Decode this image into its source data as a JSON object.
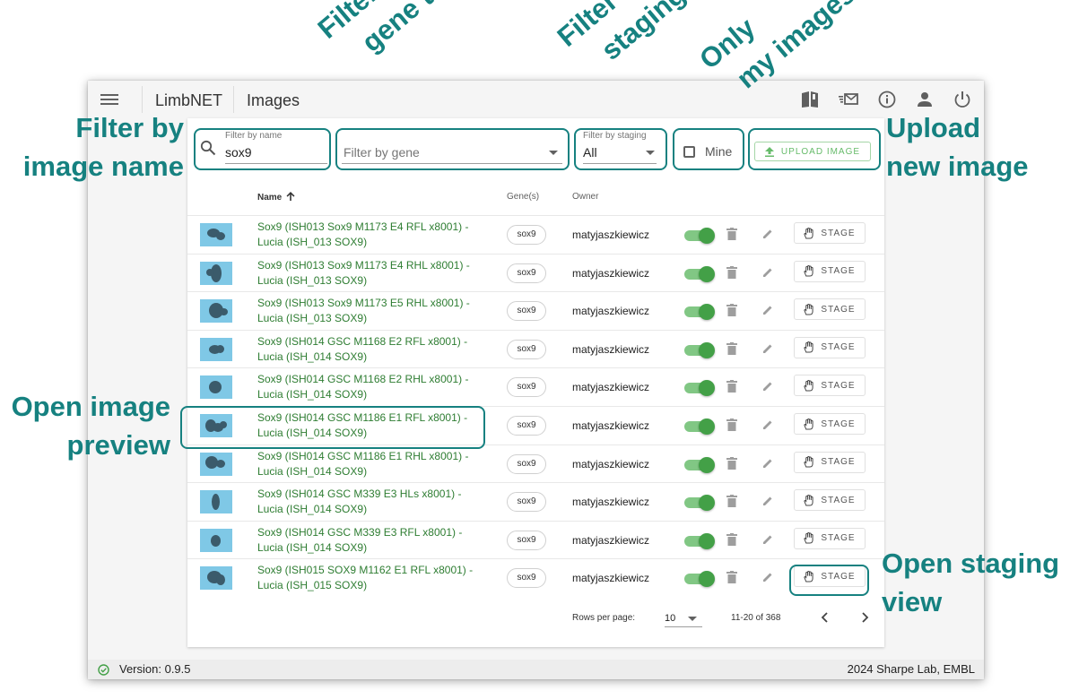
{
  "app": {
    "name": "LimbNET",
    "page_title": "Images",
    "version": "Version: 0.9.5",
    "credit": "2024 Sharpe Lab, EMBL",
    "accent_color": "#168180",
    "link_color": "#2e7d32",
    "toggle_color": "#43a047"
  },
  "header_icons": [
    "book-icon",
    "mail-icon",
    "info-icon",
    "account-icon",
    "power-icon"
  ],
  "filters": {
    "name_label": "Filter by name",
    "name_value": "sox9",
    "gene_placeholder": "Filter by gene",
    "staging_label": "Filter by staging",
    "staging_value": "All",
    "mine_label": "Mine",
    "upload_label": "UPLOAD IMAGE"
  },
  "table": {
    "columns": {
      "name": "Name",
      "genes": "Gene(s)",
      "owner": "Owner"
    },
    "sort_icon": "arrow-up-icon",
    "stage_label": "STAGE",
    "rows": [
      {
        "line1": "Sox9 (ISH013 Sox9 M1173 E4 RFL x8001) -",
        "line2": "Lucia (ISH_013 SOX9)",
        "gene": "sox9",
        "owner": "matyjaszkiewicz",
        "public": true
      },
      {
        "line1": "Sox9 (ISH013 Sox9 M1173 E4 RHL x8001) -",
        "line2": "Lucia (ISH_013 SOX9)",
        "gene": "sox9",
        "owner": "matyjaszkiewicz",
        "public": true
      },
      {
        "line1": "Sox9 (ISH013 Sox9 M1173 E5 RHL x8001) -",
        "line2": "Lucia (ISH_013 SOX9)",
        "gene": "sox9",
        "owner": "matyjaszkiewicz",
        "public": true
      },
      {
        "line1": "Sox9 (ISH014 GSC M1168 E2 RFL x8001) -",
        "line2": "Lucia (ISH_014 SOX9)",
        "gene": "sox9",
        "owner": "matyjaszkiewicz",
        "public": true
      },
      {
        "line1": "Sox9 (ISH014 GSC M1168 E2 RHL x8001) -",
        "line2": "Lucia (ISH_014 SOX9)",
        "gene": "sox9",
        "owner": "matyjaszkiewicz",
        "public": true
      },
      {
        "line1": "Sox9 (ISH014 GSC M1186 E1 RFL x8001) -",
        "line2": "Lucia (ISH_014 SOX9)",
        "gene": "sox9",
        "owner": "matyjaszkiewicz",
        "public": true
      },
      {
        "line1": "Sox9 (ISH014 GSC M1186 E1 RHL x8001) -",
        "line2": "Lucia (ISH_014 SOX9)",
        "gene": "sox9",
        "owner": "matyjaszkiewicz",
        "public": true
      },
      {
        "line1": "Sox9 (ISH014 GSC M339 E3 HLs x8001) -",
        "line2": "Lucia (ISH_014 SOX9)",
        "gene": "sox9",
        "owner": "matyjaszkiewicz",
        "public": true
      },
      {
        "line1": "Sox9 (ISH014 GSC M339 E3 RFL x8001) -",
        "line2": "Lucia (ISH_014 SOX9)",
        "gene": "sox9",
        "owner": "matyjaszkiewicz",
        "public": true
      },
      {
        "line1": "Sox9 (ISH015 SOX9 M1162 E1 RFL x8001) -",
        "line2": "Lucia (ISH_015 SOX9)",
        "gene": "sox9",
        "owner": "matyjaszkiewicz",
        "public": true
      }
    ]
  },
  "pagination": {
    "rows_per_page_label": "Rows per page:",
    "rows_per_page": "10",
    "range": "11-20 of 368"
  },
  "annotations": {
    "filter_name": [
      "Filter by",
      "image name"
    ],
    "filter_gene": [
      "Filter by",
      "gene tag"
    ],
    "filter_staging": [
      "Filter by",
      "staging"
    ],
    "only_mine": [
      "Only",
      "my images"
    ],
    "upload": [
      "Upload",
      "new image"
    ],
    "preview": [
      "Open image",
      "preview"
    ],
    "staging_view": [
      "Open staging",
      "view"
    ]
  }
}
